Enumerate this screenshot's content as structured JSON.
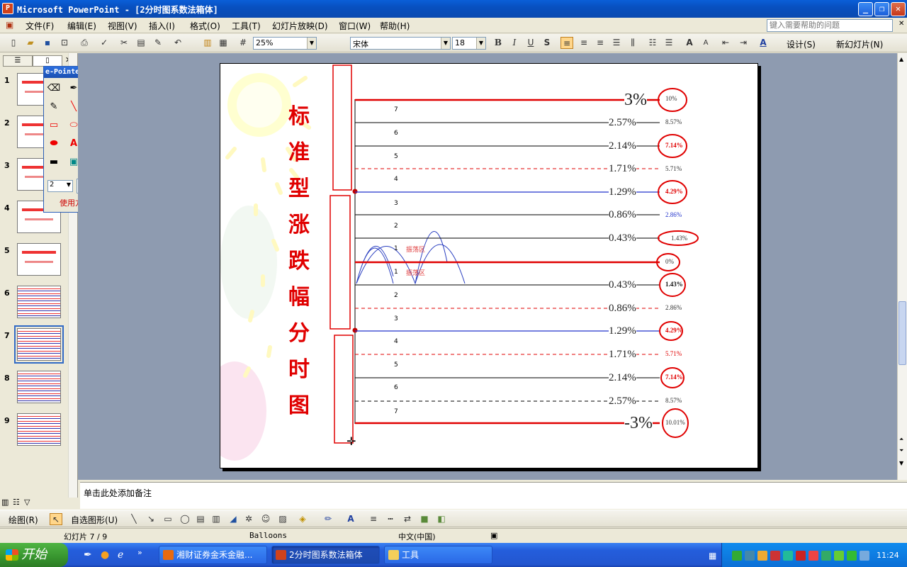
{
  "window": {
    "title": "Microsoft PowerPoint - [2分时图系数法箱体]",
    "app_icon": "P"
  },
  "menu": {
    "items": [
      "文件(F)",
      "编辑(E)",
      "视图(V)",
      "插入(I)",
      "格式(O)",
      "工具(T)",
      "幻灯片放映(D)",
      "窗口(W)",
      "帮助(H)"
    ],
    "help_placeholder": "键入需要帮助的问题"
  },
  "toolbar": {
    "zoom": "25%",
    "font": "宋体",
    "font_size": "18",
    "bold": "B",
    "italic": "I",
    "underline": "U",
    "shadow": "S",
    "design_label": "设计(S)",
    "new_slide_label": "新幻灯片(N)"
  },
  "left_panel": {
    "slide_numbers": [
      "1",
      "2",
      "3",
      "4",
      "5",
      "6",
      "7",
      "8",
      "9"
    ],
    "selected": "7"
  },
  "epointer": {
    "title": "e-Pointer",
    "width_value": "2",
    "help_label": "使用方法"
  },
  "slide": {
    "vertical_title": [
      "标",
      "准",
      "型",
      "涨",
      "跌",
      "幅",
      "分",
      "时",
      "图"
    ],
    "labels_upper": [
      "7",
      "6",
      "5",
      "4",
      "3",
      "2",
      "1"
    ],
    "labels_lower": [
      "1",
      "2",
      "3",
      "4",
      "5",
      "6",
      "7"
    ],
    "zone_labels": [
      "振荡区",
      "振荡区"
    ],
    "center_pcts": [
      "3%",
      "2.57%",
      "2.14%",
      "1.71%",
      "1.29%",
      "0.86%",
      "0.43%",
      "0.43%",
      "0.86%",
      "1.29%",
      "1.71%",
      "2.14%",
      "2.57%",
      "-3%"
    ],
    "right_pcts_upper": [
      "10%",
      "8.57%",
      "7.14%",
      "5.71%",
      "4.29%",
      "2.86%",
      "1.43%",
      "0%"
    ],
    "right_pcts_lower": [
      "1.43%",
      "2.86%",
      "4.29%",
      "5.71%",
      "7.14%",
      "8.57%",
      "10.01%"
    ]
  },
  "notes": {
    "placeholder": "单击此处添加备注"
  },
  "drawing": {
    "draw_label": "绘图(R)",
    "autoshape_label": "自选图形(U)"
  },
  "status": {
    "slide": "幻灯片 7 / 9",
    "design": "Balloons",
    "language": "中文(中国)"
  },
  "taskbar": {
    "start": "开始",
    "tasks": [
      "湘财证券金禾金融...",
      "2分时图系数法箱体",
      "工具"
    ],
    "time": "11:24"
  },
  "colors": {
    "accent_red": "#E00000",
    "line_blue": "#2233CC",
    "title_blue": "#0A5FD8",
    "taskbar_green": "#37942E"
  }
}
